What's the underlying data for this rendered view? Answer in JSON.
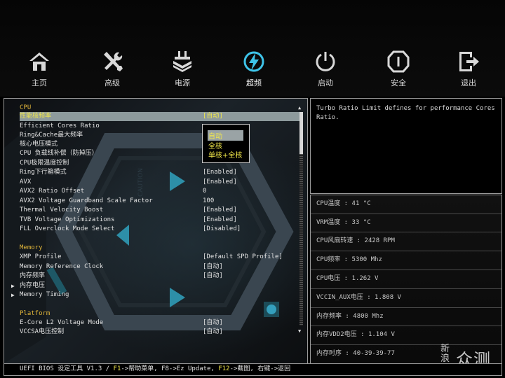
{
  "nav": {
    "items": [
      {
        "label": "主页",
        "icon": "home-icon"
      },
      {
        "label": "高级",
        "icon": "tools-icon"
      },
      {
        "label": "电源",
        "icon": "power-plug-icon"
      },
      {
        "label": "超频",
        "icon": "overclock-lightning-icon"
      },
      {
        "label": "启动",
        "icon": "power-button-icon"
      },
      {
        "label": "安全",
        "icon": "security-shield-icon"
      },
      {
        "label": "退出",
        "icon": "exit-icon"
      }
    ],
    "active": "超频",
    "accent_color": "#3ec3e8"
  },
  "sections": {
    "cpu": {
      "title": "CPU",
      "rows": [
        {
          "label": "性能核频率",
          "value": "[自动]"
        },
        {
          "label": "Efficient Cores Ratio",
          "value": ""
        },
        {
          "label": "Ring&Cache最大频率",
          "value": ""
        },
        {
          "label": "核心电压模式",
          "value": ""
        },
        {
          "label": "CPU 负载线补偿（防掉压）",
          "value": ""
        },
        {
          "label": "CPU极限温度控制",
          "value": ""
        },
        {
          "label": "Ring下行箱模式",
          "value": "[Enabled]"
        },
        {
          "label": "AVX",
          "value": "[Enabled]"
        },
        {
          "label": "AVX2 Ratio Offset",
          "value": "0"
        },
        {
          "label": "AVX2 Voltage Guardband Scale Factor",
          "value": "100"
        },
        {
          "label": "Thermal Velocity Boost",
          "value": "[Enabled]"
        },
        {
          "label": "TVB Voltage Optimizations",
          "value": "[Enabled]"
        },
        {
          "label": "FLL Overclock Mode Select",
          "value": "[Disabled]"
        }
      ]
    },
    "memory": {
      "title": "Memory",
      "rows": [
        {
          "label": "XMP Profile",
          "value": "[Default SPD Profile]"
        },
        {
          "label": "Memory Reference Clock",
          "value": "[自动]"
        },
        {
          "label": "内存频率",
          "value": "[自动]"
        },
        {
          "label": "内存电压",
          "value": ""
        },
        {
          "label": "Memory Timing",
          "value": ""
        }
      ]
    },
    "platform": {
      "title": "Platform",
      "rows": [
        {
          "label": "E-Core L2 Voltage Mode",
          "value": "[自动]"
        },
        {
          "label": "VCCSA电压控制",
          "value": "[自动]"
        }
      ]
    }
  },
  "dropdown": {
    "options": [
      "自动",
      "全核",
      "单核+全核"
    ],
    "selected": "自动"
  },
  "help": {
    "text": "Turbo Ratio Limit defines for performance Cores Ratio."
  },
  "status": [
    {
      "label": "CPU温度",
      "value": " : 41 °C"
    },
    {
      "label": "VRM温度",
      "value": " : 33 °C"
    },
    {
      "label": "CPU风扇转速",
      "value": " : 2428 RPM"
    },
    {
      "label": "CPU频率",
      "value": " : 5300 Mhz"
    },
    {
      "label": "CPU电压",
      "value": " : 1.262 V"
    },
    {
      "label": "VCCIN_AUX电压",
      "value": " : 1.808 V"
    },
    {
      "label": "内存频率",
      "value": " : 4800 Mhz"
    },
    {
      "label": "内存VDD2电压",
      "value": " : 1.104 V"
    },
    {
      "label": "内存时序",
      "value": " : 40-39-39-77"
    }
  ],
  "footer": {
    "part1": "UEFI BIOS 设定工具 V1.3 / ",
    "key1": "F1",
    "part2": "->帮助菜单, F8->Ez Update, ",
    "key2": "F12",
    "part3": "->截图, 右键->返回"
  },
  "watermark": {
    "small": "新浪",
    "big": "众测"
  },
  "colors": {
    "highlight_text": "#f2e84a",
    "section_title": "#e0b53a",
    "selection_bg": "#8d9a9c"
  }
}
